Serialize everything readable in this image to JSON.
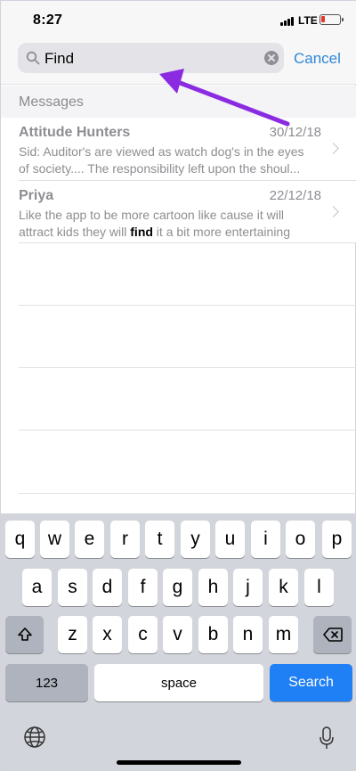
{
  "status": {
    "time": "8:27",
    "network": "LTE"
  },
  "search": {
    "query": "Find",
    "cancel_label": "Cancel"
  },
  "section": {
    "title": "Messages"
  },
  "messages": [
    {
      "name": "Attitude Hunters",
      "date": "30/12/18",
      "line1": "Sid: Auditor's are viewed as watch dog's in the eyes",
      "line2": "of society.... The responsibility left upon the shoul..."
    },
    {
      "name": "Priya",
      "date": "22/12/18",
      "line1": "Like the app to be more cartoon like cause it will",
      "line2_before": "attract kids they will ",
      "line2_highlight": "find",
      "line2_after": " it a bit more entertaining"
    }
  ],
  "keyboard": {
    "row1": [
      "q",
      "w",
      "e",
      "r",
      "t",
      "y",
      "u",
      "i",
      "o",
      "p"
    ],
    "row2": [
      "a",
      "s",
      "d",
      "f",
      "g",
      "h",
      "j",
      "k",
      "l"
    ],
    "row3": [
      "z",
      "x",
      "c",
      "v",
      "b",
      "n",
      "m"
    ],
    "numbers_label": "123",
    "space_label": "space",
    "search_label": "Search"
  },
  "colors": {
    "accent": "#2f87d6",
    "search_key": "#1f7ff5",
    "annotation_arrow": "#8a2be2"
  },
  "icons": [
    "search-icon",
    "clear-icon",
    "chevron-right-icon",
    "shift-icon",
    "backspace-icon",
    "globe-icon",
    "microphone-icon",
    "cellular-signal-icon",
    "battery-icon"
  ]
}
